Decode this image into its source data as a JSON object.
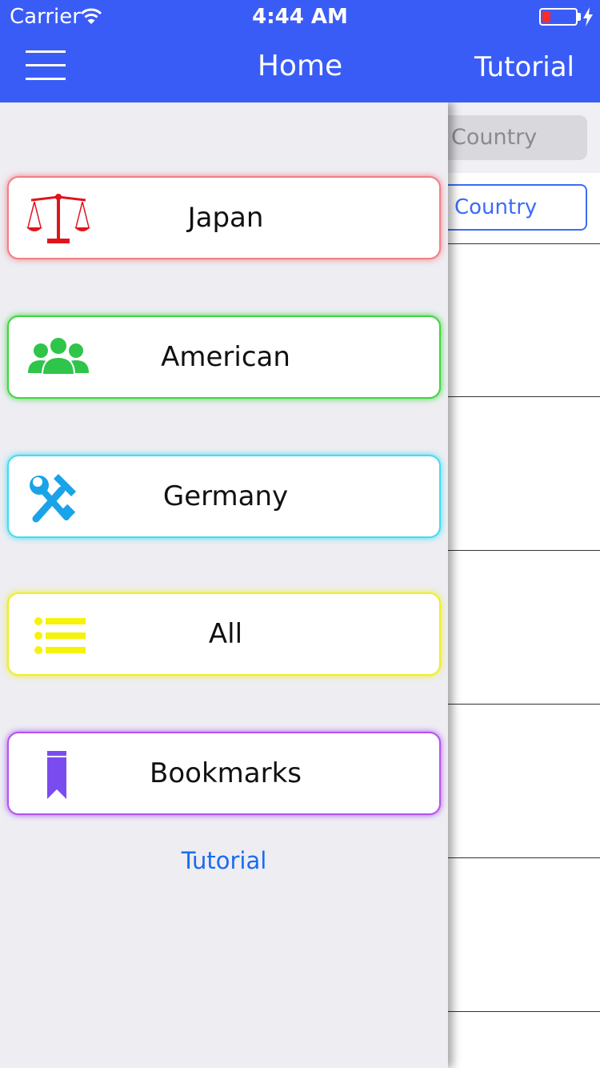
{
  "status_bar": {
    "carrier": "Carrier",
    "time": "4:44 AM"
  },
  "nav": {
    "title": "Home",
    "right_button": "Tutorial"
  },
  "background": {
    "search_placeholder": "Country",
    "segment_label": "Country"
  },
  "drawer": {
    "items": [
      {
        "label": "Japan",
        "icon": "scales-icon",
        "color": "#f07f84"
      },
      {
        "label": "American",
        "icon": "group-icon",
        "color": "#41d641"
      },
      {
        "label": "Germany",
        "icon": "tools-icon",
        "color": "#43dcf0"
      },
      {
        "label": "All",
        "icon": "list-icon",
        "color": "#eeee2a"
      },
      {
        "label": "Bookmarks",
        "icon": "bookmark-icon",
        "color": "#b154ef"
      }
    ],
    "footer_link": "Tutorial"
  },
  "colors": {
    "nav_background": "#3a5cf6",
    "link": "#1a6cf0",
    "battery_low": "#ff2a2a"
  }
}
